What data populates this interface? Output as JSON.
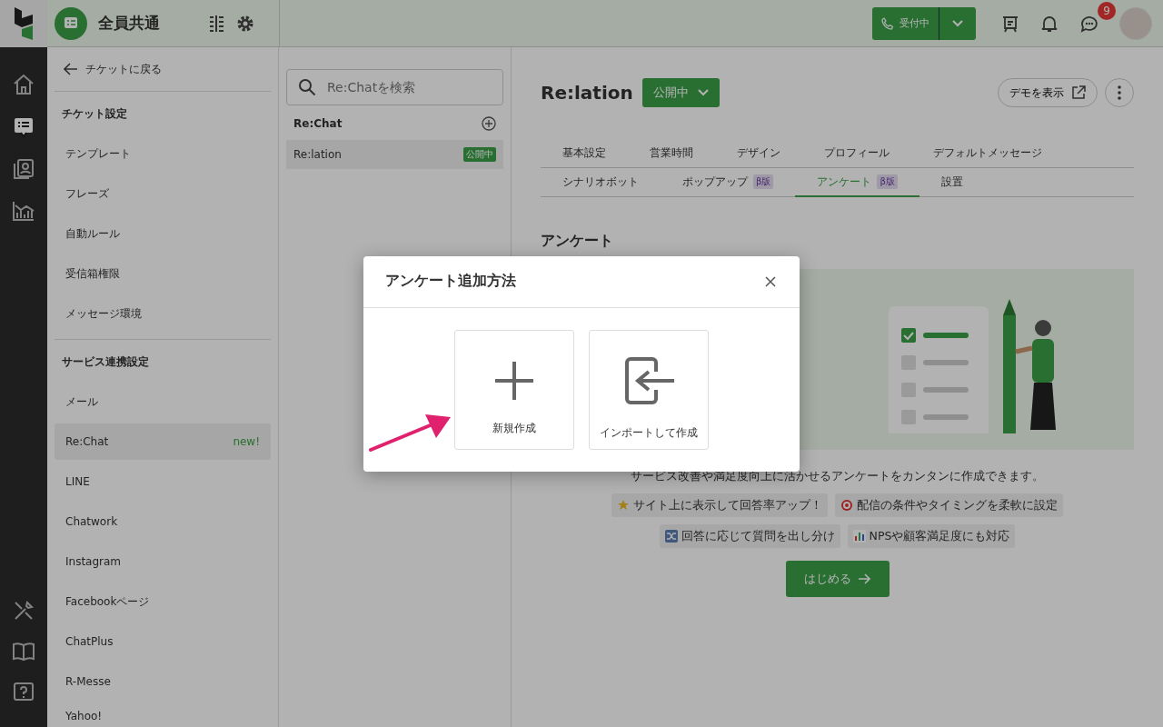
{
  "header": {
    "workspace": "全員共通",
    "status_button": "受付中",
    "notification_count": "9"
  },
  "sidebar": {
    "back": "チケットに戻る",
    "sections": [
      {
        "title": "チケット設定",
        "items": [
          {
            "label": "テンプレート",
            "selected": false
          },
          {
            "label": "フレーズ",
            "selected": false
          },
          {
            "label": "自動ルール",
            "selected": false
          },
          {
            "label": "受信箱権限",
            "selected": false
          },
          {
            "label": "メッセージ環境",
            "selected": false
          }
        ]
      },
      {
        "title": "サービス連携設定",
        "items": [
          {
            "label": "メール",
            "selected": false
          },
          {
            "label": "Re:Chat",
            "selected": true,
            "badge": "new!"
          },
          {
            "label": "LINE",
            "selected": false
          },
          {
            "label": "Chatwork",
            "selected": false
          },
          {
            "label": "Instagram",
            "selected": false
          },
          {
            "label": "Facebookページ",
            "selected": false
          },
          {
            "label": "ChatPlus",
            "selected": false
          },
          {
            "label": "R-Messe",
            "selected": false
          },
          {
            "label": "Yahoo!",
            "selected": false
          }
        ]
      }
    ]
  },
  "list": {
    "search_placeholder": "Re:Chatを検索",
    "title": "Re:Chat",
    "items": [
      {
        "label": "Re:lation",
        "status": "公開中",
        "selected": true
      }
    ]
  },
  "main": {
    "title": "Re:lation",
    "status": "公開中",
    "demo_button": "デモを表示",
    "tab_rows": [
      [
        {
          "label": "基本設定",
          "selected": false
        },
        {
          "label": "営業時間",
          "selected": false
        },
        {
          "label": "デザイン",
          "selected": false
        },
        {
          "label": "プロフィール",
          "selected": false
        },
        {
          "label": "デフォルトメッセージ",
          "selected": false
        }
      ],
      [
        {
          "label": "シナリオボット",
          "selected": false
        },
        {
          "label": "ポップアップ",
          "badge": "β版",
          "selected": false
        },
        {
          "label": "アンケート",
          "badge": "β版",
          "selected": true
        },
        {
          "label": "設置",
          "selected": false
        }
      ]
    ],
    "section_title": "アンケート",
    "description": "サービス改善や満足度向上に活かせるアンケートをカンタンに作成できます。",
    "feature_rows": [
      [
        {
          "kind": "star",
          "text": "サイト上に表示して回答率アップ！"
        },
        {
          "kind": "target",
          "text": "配信の条件やタイミングを柔軟に設定"
        }
      ],
      [
        {
          "kind": "shuffle",
          "text": "回答に応じて質問を出し分け"
        },
        {
          "kind": "chart",
          "text": "NPSや顧客満足度にも対応"
        }
      ]
    ],
    "start_button": "はじめる"
  },
  "modal": {
    "title": "アンケート追加方法",
    "options": [
      {
        "kind": "new",
        "label": "新規作成"
      },
      {
        "kind": "import",
        "label": "インポートして作成"
      }
    ]
  }
}
